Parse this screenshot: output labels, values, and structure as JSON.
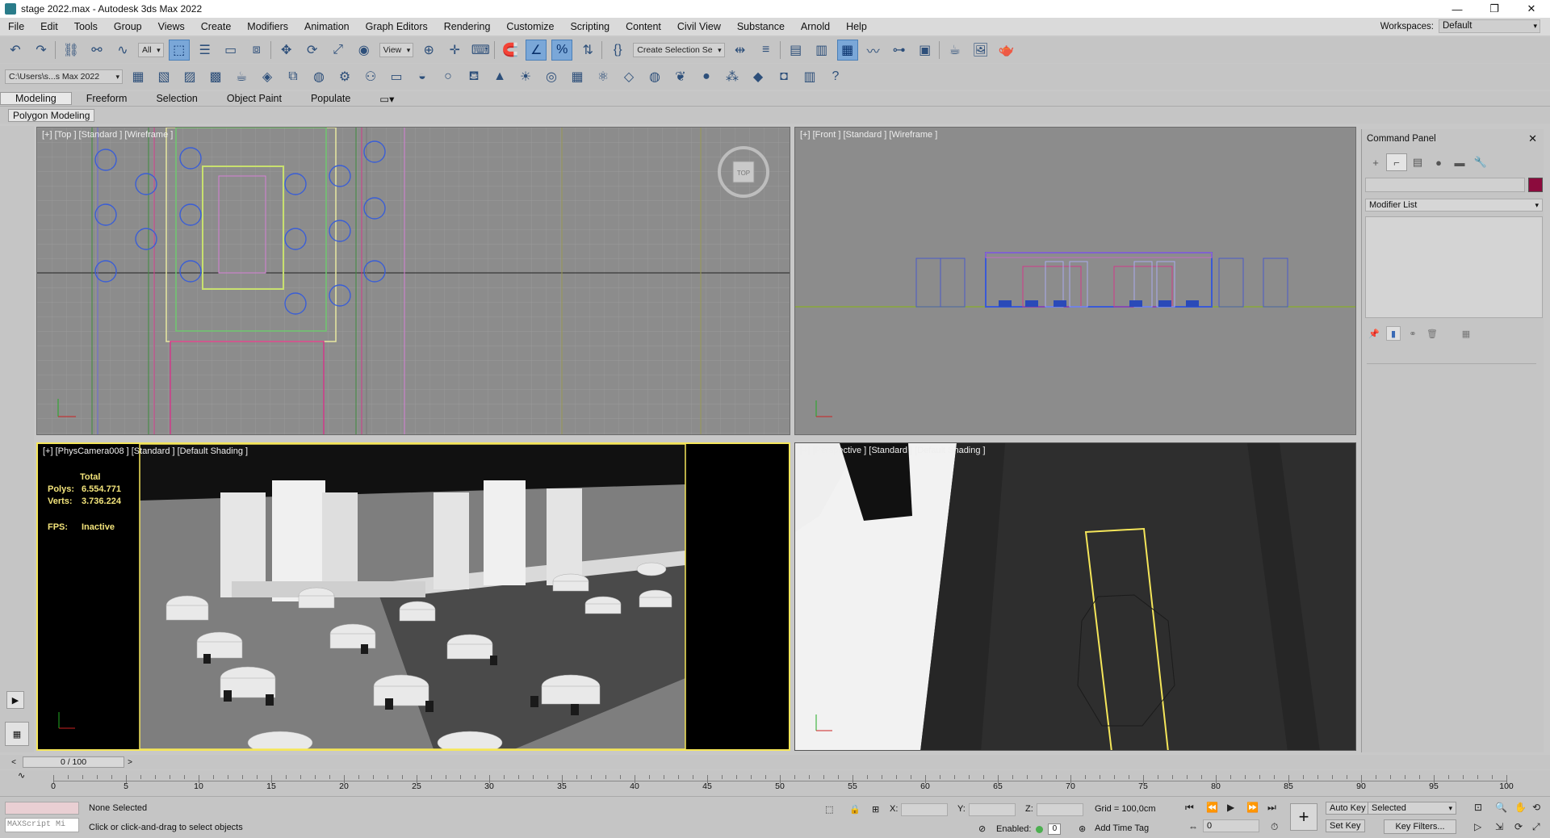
{
  "window": {
    "title": "stage 2022.max - Autodesk 3ds Max 2022",
    "min": "—",
    "restore": "❐",
    "close": "✕"
  },
  "menu": [
    "File",
    "Edit",
    "Tools",
    "Group",
    "Views",
    "Create",
    "Modifiers",
    "Animation",
    "Graph Editors",
    "Rendering",
    "Customize",
    "Scripting",
    "Content",
    "Civil View",
    "Substance",
    "Arnold",
    "Help"
  ],
  "workspace": {
    "label": "Workspaces:",
    "value": "Default"
  },
  "toolbar1": {
    "filter": "All",
    "view": "View",
    "selection_set": "Create Selection Se"
  },
  "toolbar2": {
    "path": "C:\\Users\\s...s Max 2022"
  },
  "ribbon": {
    "tabs": [
      "Modeling",
      "Freeform",
      "Selection",
      "Object Paint",
      "Populate"
    ],
    "active_tab": "Modeling",
    "panel": "Polygon Modeling"
  },
  "viewports": {
    "top": {
      "label": "[+] [Top ] [Standard ] [Wireframe ]",
      "cube_label": "TOP"
    },
    "front": {
      "label": "[+] [Front ] [Standard ] [Wireframe ]"
    },
    "camera": {
      "label": "[+] [PhysCamera008 ] [Standard ] [Default Shading ]"
    },
    "persp": {
      "label": "[+] [Perspective ] [Standard ] [Default Shading ]"
    }
  },
  "stats": {
    "total": "Total",
    "polys_label": "Polys:",
    "polys": "6.554.771",
    "verts_label": "Verts:",
    "verts": "3.736.224",
    "fps_label": "FPS:",
    "fps": "Inactive"
  },
  "command_panel": {
    "title": "Command Panel",
    "modifier_list": "Modifier List",
    "object_color": "#8c0b3d"
  },
  "timeline": {
    "frame": "0 / 100",
    "ticks": [
      "0",
      "5",
      "10",
      "15",
      "20",
      "25",
      "30",
      "35",
      "40",
      "45",
      "50",
      "55",
      "60",
      "65",
      "70",
      "75",
      "80",
      "85",
      "90",
      "95",
      "100"
    ]
  },
  "status": {
    "selection": "None Selected",
    "hint": "Click or click-and-drag to select objects",
    "maxscript": "MAXScript Mi",
    "x": "X:",
    "y": "Y:",
    "z": "Z:",
    "grid": "Grid = 100,0cm",
    "enabled": "Enabled:",
    "enabled_value": "0",
    "add_time_tag": "Add Time Tag",
    "auto_key": "Auto Key",
    "set_key": "Set Key",
    "key_mode": "Selected",
    "key_filters": "Key Filters...",
    "frame_value": "0"
  }
}
